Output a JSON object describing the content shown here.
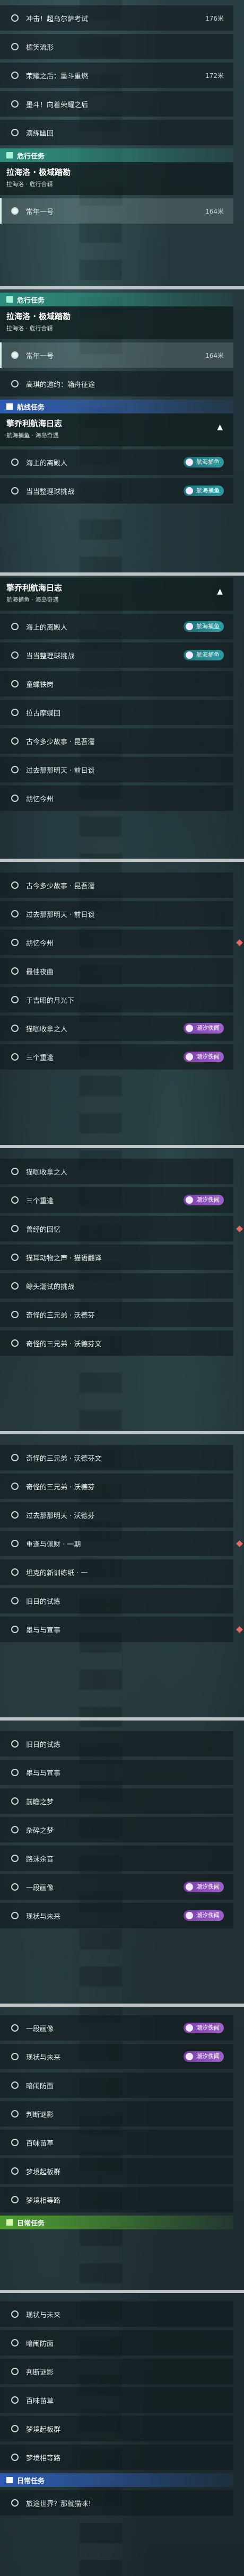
{
  "colors": {
    "accent_teal": "#2c8f7e",
    "accent_green": "#4c9c2e",
    "accent_blue": "#2d5bb4",
    "badge_purple": "#8a4ab6",
    "marker_red": "#e46a6a"
  },
  "s1": {
    "rows": [
      {
        "label": "冲击！超乌尔萨考试",
        "dist": "176米"
      },
      {
        "label": "楣笑流形",
        "dist": ""
      },
      {
        "label": "荣耀之后：墨斗重燃",
        "dist": "172米"
      },
      {
        "label": "墨斗！向着荣耀之后",
        "dist": ""
      },
      {
        "label": "演练幽回",
        "dist": ""
      }
    ],
    "category": "危行任务",
    "header": {
      "title": "拉海洛 · 极域踏勘",
      "subtitle": "拉海洛 · 危行合辑"
    },
    "selected": {
      "label": "常年一号",
      "dist": "164米"
    }
  },
  "s2": {
    "category": "危行任务",
    "header": {
      "title": "拉海洛 · 极域踏勘",
      "subtitle": "拉海洛 · 危行合辑"
    },
    "selected": {
      "label": "常年一号",
      "dist": "164米"
    },
    "rows": [
      {
        "label": "高琪的邀约：箱舟征途",
        "dist": ""
      }
    ],
    "category2": "航线任务",
    "header2": {
      "title": "擎乔利航海日志",
      "subtitle": "航海捕鱼 · 海岛奇遇"
    },
    "rows2": [
      {
        "label": "海上的离殿人",
        "badge": "航海捕鱼"
      },
      {
        "label": "当当整理球挑战",
        "badge": "航海捕鱼"
      }
    ]
  },
  "s3": {
    "header": {
      "title": "擎乔利航海日志",
      "subtitle": "航海捕鱼 · 海岛奇遇"
    },
    "rows": [
      {
        "label": "海上的离殿人",
        "badge": "航海捕鱼"
      },
      {
        "label": "当当整理球挑战",
        "badge": "航海捕鱼"
      },
      {
        "label": "童蝶铁岗",
        "badge": ""
      },
      {
        "label": "拉古摩蝶回",
        "badge": ""
      },
      {
        "label": "古今多少故事 · 昆吾濡",
        "badge": ""
      },
      {
        "label": "过去那那明天 · 前日谈",
        "badge": ""
      },
      {
        "label": "胡忆今州",
        "badge": ""
      }
    ]
  },
  "s4": {
    "rows": [
      {
        "label": "古今多少故事 · 昆吾濡",
        "badge": ""
      },
      {
        "label": "过去那那明天 · 前日谈",
        "badge": ""
      },
      {
        "label": "胡忆今州",
        "badge": ""
      },
      {
        "label": "最佳夜曲",
        "badge": ""
      },
      {
        "label": "于吉昭的月光下",
        "badge": ""
      },
      {
        "label": "猫咖收拿之人",
        "badge": "潮汐佚闻"
      },
      {
        "label": "三个重逢",
        "badge": "潮汐佚闻"
      }
    ]
  },
  "s5": {
    "rows": [
      {
        "label": "猫咖收拿之人",
        "badge": "潮汐佚闻"
      },
      {
        "label": "三个重逢",
        "badge": "潮汐佚闻"
      },
      {
        "label": "曾经的回忆",
        "badge": ""
      },
      {
        "label": "猫耳动物之声 · 猫语翻译",
        "badge": ""
      },
      {
        "label": "鲸头潮试的挑战",
        "badge": ""
      },
      {
        "label": "奇怪的三兄弟 · 沃德芬",
        "badge": ""
      },
      {
        "label": "奇怪的三兄弟 · 沃德芬文",
        "badge": ""
      }
    ]
  },
  "s6": {
    "rows": [
      {
        "label": "奇怪的三兄弟 · 沃德芬文",
        "badge": ""
      },
      {
        "label": "奇怪的三兄弟 · 沃德芬",
        "badge": ""
      },
      {
        "label": "过去那那明天 · 沃德芬",
        "badge": ""
      },
      {
        "label": "重逢与佩财 · 一期",
        "badge": ""
      },
      {
        "label": "坦克的新训练纸 · 一",
        "badge": ""
      },
      {
        "label": "旧日的试炼",
        "badge": ""
      },
      {
        "label": "墨与与宣事",
        "badge": ""
      }
    ]
  },
  "s7": {
    "rows": [
      {
        "label": "旧日的试炼",
        "badge": ""
      },
      {
        "label": "墨与与宣事",
        "badge": ""
      },
      {
        "label": "前瞻之梦",
        "badge": ""
      },
      {
        "label": "杂碎之梦",
        "badge": ""
      },
      {
        "label": "路沫余音",
        "badge": ""
      },
      {
        "label": "一段画像",
        "badge": "潮汐佚闻"
      },
      {
        "label": "现状与未来",
        "badge": "潮汐佚闻"
      }
    ]
  },
  "s8": {
    "rows": [
      {
        "label": "一段画像",
        "badge": "潮汐佚闻"
      },
      {
        "label": "现状与未来",
        "badge": "潮汐佚闻"
      },
      {
        "label": "暗闹防面",
        "badge": ""
      },
      {
        "label": "判断谜影",
        "badge": ""
      },
      {
        "label": "百味苗草",
        "badge": ""
      },
      {
        "label": "梦境起板群",
        "badge": ""
      },
      {
        "label": "梦境相等路",
        "badge": ""
      }
    ],
    "category": "日常任务"
  },
  "s9": {
    "rows": [
      {
        "label": "现状与未来",
        "badge": ""
      },
      {
        "label": "暗闹防面",
        "badge": ""
      },
      {
        "label": "判断谜影",
        "badge": ""
      },
      {
        "label": "百味苗草",
        "badge": ""
      },
      {
        "label": "梦境起板群",
        "badge": ""
      },
      {
        "label": "梦境相等路",
        "badge": ""
      }
    ],
    "category": "日常任务",
    "daily": {
      "label": "旅途世界？那就猫咪！",
      "dist": ""
    }
  }
}
